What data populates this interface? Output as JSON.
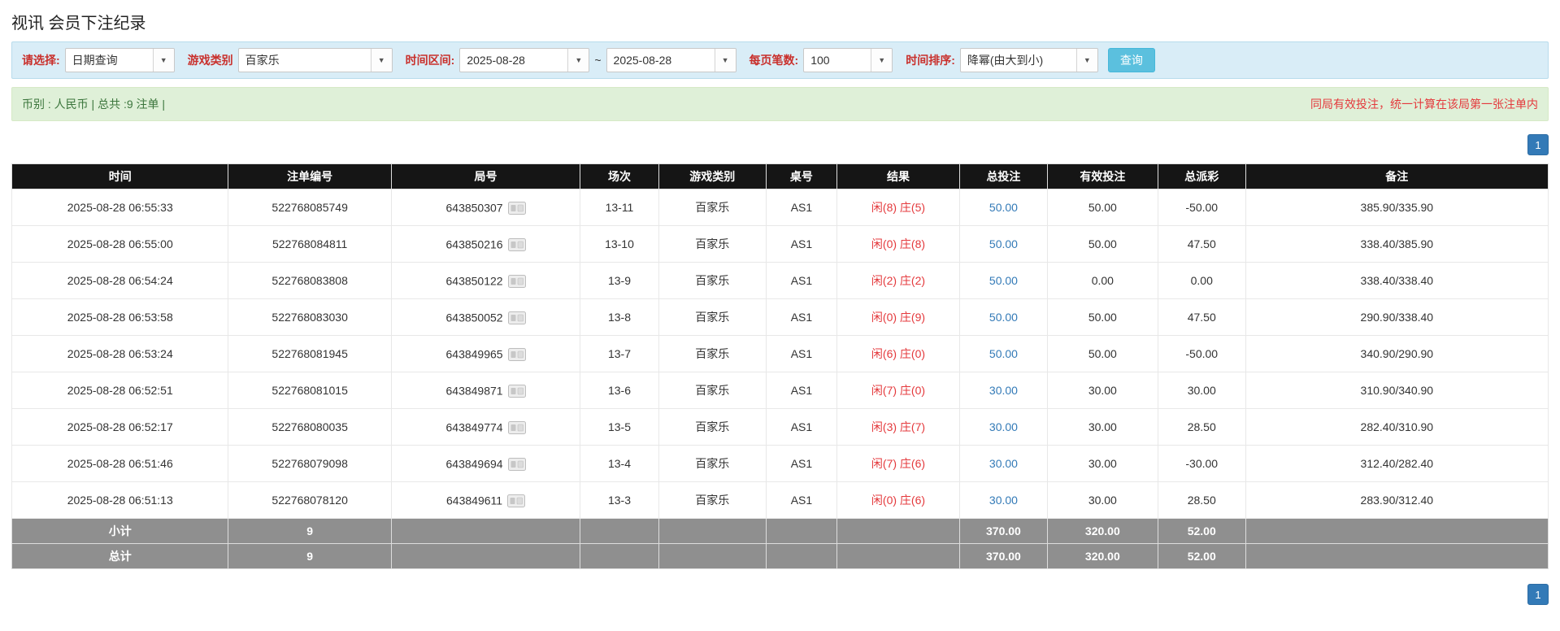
{
  "colors": {
    "filter_bar_bg": "#d9edf7",
    "filter_label_red": "#c9302c",
    "summary_bar_bg": "#dff0d8",
    "summary_text_green": "#3c763d",
    "notice_red": "#e4393c",
    "table_header_bg": "#151515",
    "total_bet_link_blue": "#337ab7",
    "negative_payout_red": "#e4393c",
    "result_text_red": "#e4393c",
    "footer_row_bg": "#8f8f8f",
    "search_button_bg": "#5bc0de",
    "pagination_bg": "#337ab7"
  },
  "page": {
    "title": "视讯 会员下注纪录"
  },
  "filters": {
    "select_label": "请选择:",
    "select_value": "日期查询",
    "game_type_label": "游戏类别",
    "game_type_value": "百家乐",
    "date_range_label": "时间区间:",
    "date_from": "2025-08-28",
    "range_separator": "~",
    "date_to": "2025-08-28",
    "page_size_label": "每页笔数:",
    "page_size_value": "100",
    "sort_label": "时间排序:",
    "sort_value": "降幂(由大到小)",
    "search_button_label": "查询"
  },
  "summary": {
    "currency_info": "币别 : 人民币 | 总共 :9 注单 |",
    "notice": "同局有效投注，统一计算在该局第一张注单内"
  },
  "pagination": {
    "current_page": "1"
  },
  "table": {
    "headers": [
      "时间",
      "注单编号",
      "局号",
      "场次",
      "游戏类别",
      "桌号",
      "结果",
      "总投注",
      "有效投注",
      "总派彩",
      "备注"
    ],
    "rows": [
      {
        "time": "2025-08-28 06:55:33",
        "bet_id": "522768085749",
        "round_id": "643850307",
        "session": "13-11",
        "game": "百家乐",
        "table_no": "AS1",
        "result_player": "闲(8)",
        "result_banker": "庄(5)",
        "total_bet": "50.00",
        "valid_bet": "50.00",
        "payout": "-50.00",
        "note": "385.90/335.90"
      },
      {
        "time": "2025-08-28 06:55:00",
        "bet_id": "522768084811",
        "round_id": "643850216",
        "session": "13-10",
        "game": "百家乐",
        "table_no": "AS1",
        "result_player": "闲(0)",
        "result_banker": "庄(8)",
        "total_bet": "50.00",
        "valid_bet": "50.00",
        "payout": "47.50",
        "note": "338.40/385.90"
      },
      {
        "time": "2025-08-28 06:54:24",
        "bet_id": "522768083808",
        "round_id": "643850122",
        "session": "13-9",
        "game": "百家乐",
        "table_no": "AS1",
        "result_player": "闲(2)",
        "result_banker": "庄(2)",
        "total_bet": "50.00",
        "valid_bet": "0.00",
        "payout": "0.00",
        "note": "338.40/338.40"
      },
      {
        "time": "2025-08-28 06:53:58",
        "bet_id": "522768083030",
        "round_id": "643850052",
        "session": "13-8",
        "game": "百家乐",
        "table_no": "AS1",
        "result_player": "闲(0)",
        "result_banker": "庄(9)",
        "total_bet": "50.00",
        "valid_bet": "50.00",
        "payout": "47.50",
        "note": "290.90/338.40"
      },
      {
        "time": "2025-08-28 06:53:24",
        "bet_id": "522768081945",
        "round_id": "643849965",
        "session": "13-7",
        "game": "百家乐",
        "table_no": "AS1",
        "result_player": "闲(6)",
        "result_banker": "庄(0)",
        "total_bet": "50.00",
        "valid_bet": "50.00",
        "payout": "-50.00",
        "note": "340.90/290.90"
      },
      {
        "time": "2025-08-28 06:52:51",
        "bet_id": "522768081015",
        "round_id": "643849871",
        "session": "13-6",
        "game": "百家乐",
        "table_no": "AS1",
        "result_player": "闲(7)",
        "result_banker": "庄(0)",
        "total_bet": "30.00",
        "valid_bet": "30.00",
        "payout": "30.00",
        "note": "310.90/340.90"
      },
      {
        "time": "2025-08-28 06:52:17",
        "bet_id": "522768080035",
        "round_id": "643849774",
        "session": "13-5",
        "game": "百家乐",
        "table_no": "AS1",
        "result_player": "闲(3)",
        "result_banker": "庄(7)",
        "total_bet": "30.00",
        "valid_bet": "30.00",
        "payout": "28.50",
        "note": "282.40/310.90"
      },
      {
        "time": "2025-08-28 06:51:46",
        "bet_id": "522768079098",
        "round_id": "643849694",
        "session": "13-4",
        "game": "百家乐",
        "table_no": "AS1",
        "result_player": "闲(7)",
        "result_banker": "庄(6)",
        "total_bet": "30.00",
        "valid_bet": "30.00",
        "payout": "-30.00",
        "note": "312.40/282.40"
      },
      {
        "time": "2025-08-28 06:51:13",
        "bet_id": "522768078120",
        "round_id": "643849611",
        "session": "13-3",
        "game": "百家乐",
        "table_no": "AS1",
        "result_player": "闲(0)",
        "result_banker": "庄(6)",
        "total_bet": "30.00",
        "valid_bet": "30.00",
        "payout": "28.50",
        "note": "283.90/312.40"
      }
    ],
    "footer_rows": [
      {
        "label": "小计",
        "count": "9",
        "total_bet": "370.00",
        "valid_bet": "320.00",
        "payout": "52.00"
      },
      {
        "label": "总计",
        "count": "9",
        "total_bet": "370.00",
        "valid_bet": "320.00",
        "payout": "52.00"
      }
    ]
  }
}
